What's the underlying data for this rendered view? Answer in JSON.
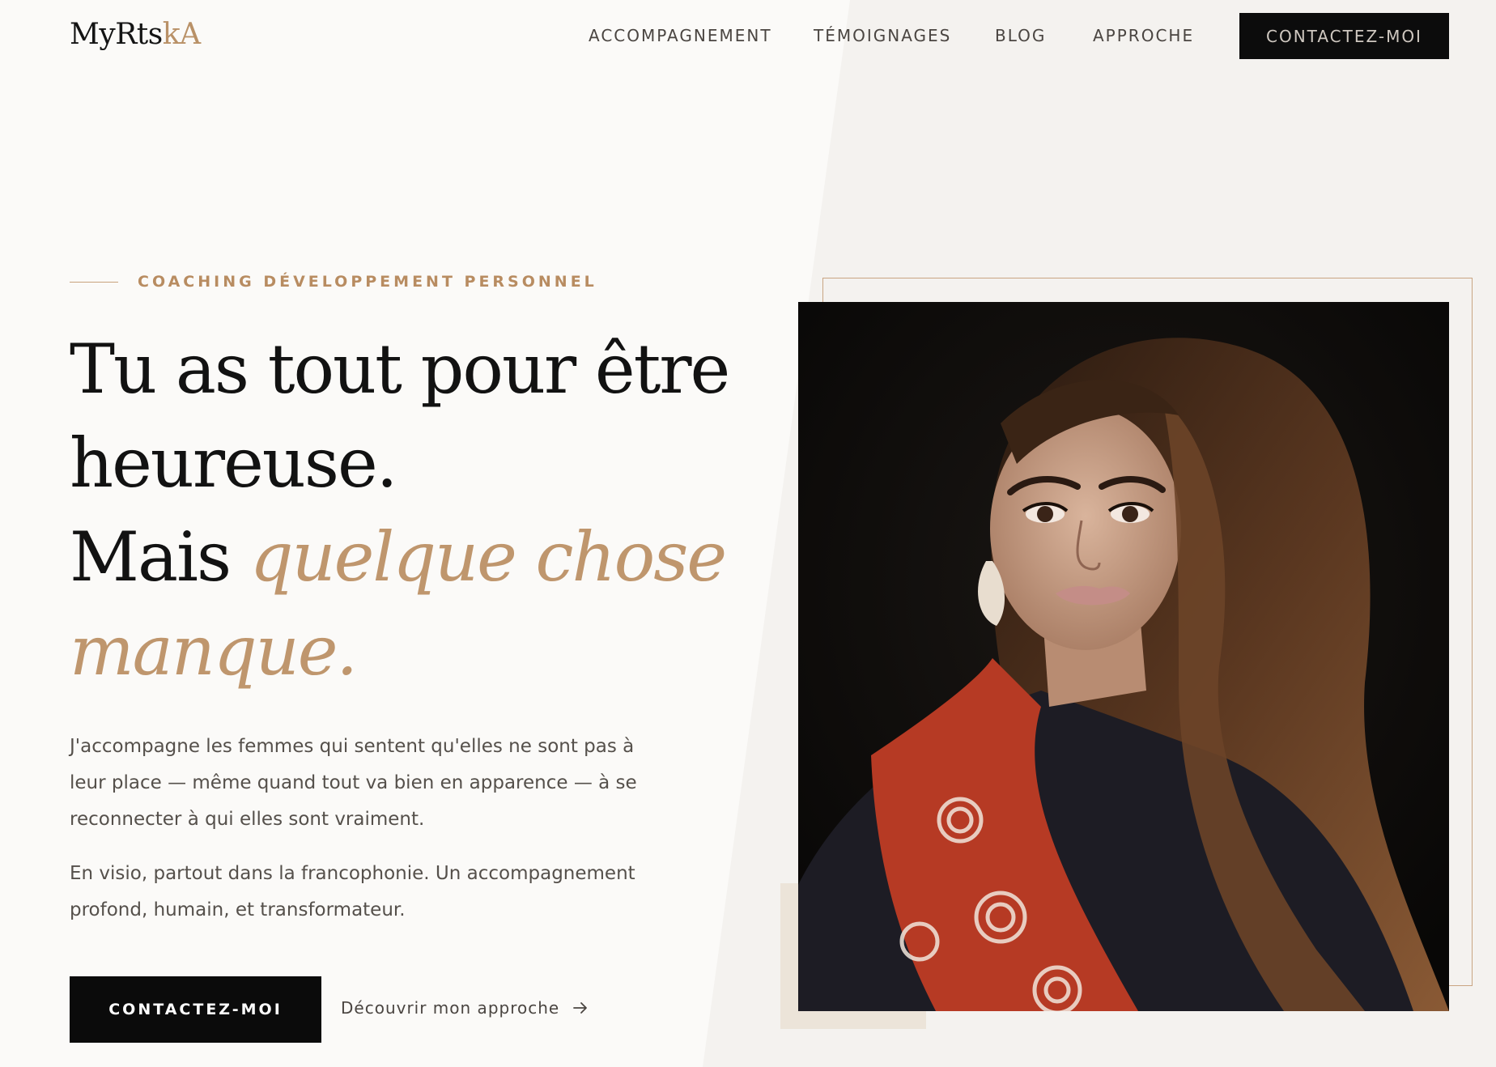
{
  "colors": {
    "background": "#fbfaf8",
    "panel": "#f4f2ef",
    "accent_gold": "#b99167",
    "dark": "#0c0c0c",
    "body_text": "#55504b"
  },
  "header": {
    "logo_main": "MyRts",
    "logo_accent": "kA",
    "nav": [
      "ACCOMPAGNEMENT",
      "TÉMOIGNAGES",
      "BLOG",
      "APPROCHE"
    ],
    "cta_label": "CONTACTEZ-MOI"
  },
  "hero": {
    "eyebrow": "COACHING DÉVELOPPEMENT PERSONNEL",
    "headline_line1": "Tu as tout pour être",
    "headline_line2": "heureuse.",
    "headline_line3_plain": "Mais ",
    "headline_line3_accent": "quelque chose",
    "headline_line4_accent": "manque.",
    "paragraph1": "J'accompagne les femmes qui sentent qu'elles ne sont pas à leur place — même quand tout va bien en apparence — à se reconnecter à qui elles sont vraiment.",
    "paragraph2": "En visio, partout dans la francophonie. Un accompagnement profond, humain, et transformateur.",
    "primary_button": "CONTACTEZ-MOI",
    "secondary_link": "Découvrir mon approche",
    "secondary_icon": "arrow-right-icon",
    "photo_subject": "portrait-photo"
  }
}
